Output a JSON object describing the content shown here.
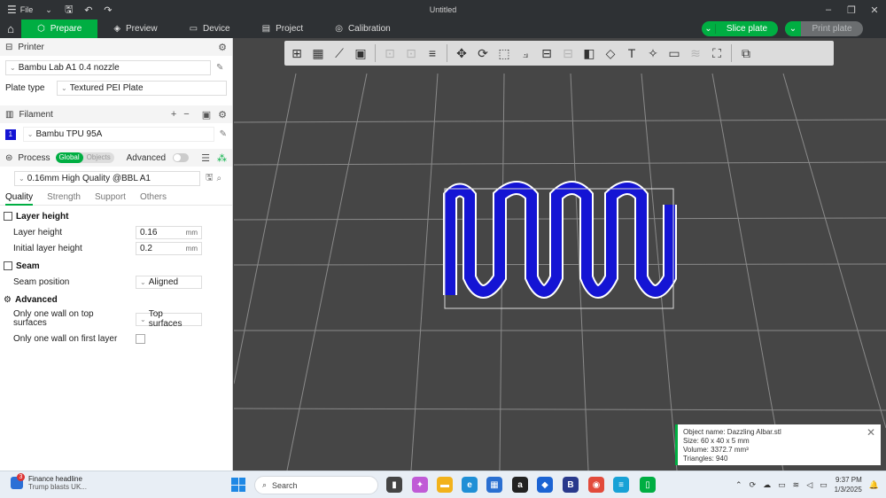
{
  "window": {
    "menu_label": "File",
    "title": "Untitled"
  },
  "tabs": [
    {
      "label": "Prepare",
      "icon": "cube-icon"
    },
    {
      "label": "Preview",
      "icon": "layers-icon"
    },
    {
      "label": "Device",
      "icon": "monitor-icon"
    },
    {
      "label": "Project",
      "icon": "document-icon"
    },
    {
      "label": "Calibration",
      "icon": "calibration-icon"
    }
  ],
  "actions": {
    "slice_label": "Slice plate",
    "print_label": "Print plate"
  },
  "printer": {
    "header": "Printer",
    "name": "Bambu Lab A1 0.4 nozzle",
    "plate_type_label": "Plate type",
    "plate_type": "Textured PEI Plate"
  },
  "filament": {
    "header": "Filament",
    "slot": "1",
    "slot_color": "#1414d4",
    "name": "Bambu TPU 95A"
  },
  "process": {
    "header": "Process",
    "scope_global": "Global",
    "scope_objects": "Objects",
    "advanced_label": "Advanced",
    "preset": "0.16mm High Quality @BBL A1"
  },
  "quality_tabs": [
    "Quality",
    "Strength",
    "Support",
    "Others"
  ],
  "groups": {
    "layer_height": {
      "title": "Layer height",
      "layer_height_label": "Layer height",
      "layer_height_value": "0.16",
      "initial_layer_height_label": "Initial layer height",
      "initial_layer_height_value": "0.2",
      "unit": "mm"
    },
    "seam": {
      "title": "Seam",
      "seam_position_label": "Seam position",
      "seam_position_value": "Aligned"
    },
    "advanced": {
      "title": "Advanced",
      "one_wall_top_label": "Only one wall on top surfaces",
      "one_wall_top_value": "Top surfaces",
      "one_wall_first_label": "Only one wall on first layer",
      "one_wall_first_checked": false
    }
  },
  "object_info": {
    "name": "Object name: Dazzling Albar.stl",
    "size": "Size: 60 x 40 x 5 mm",
    "volume": "Volume: 3372.7 mm³",
    "triangles": "Triangles: 940"
  },
  "taskbar": {
    "news_title": "Finance headline",
    "news_sub": "Trump blasts UK...",
    "search_placeholder": "Search",
    "time": "9:37 PM",
    "date": "1/3/2025"
  },
  "colors": {
    "accent": "#00ae42",
    "model": "#1414d4"
  }
}
